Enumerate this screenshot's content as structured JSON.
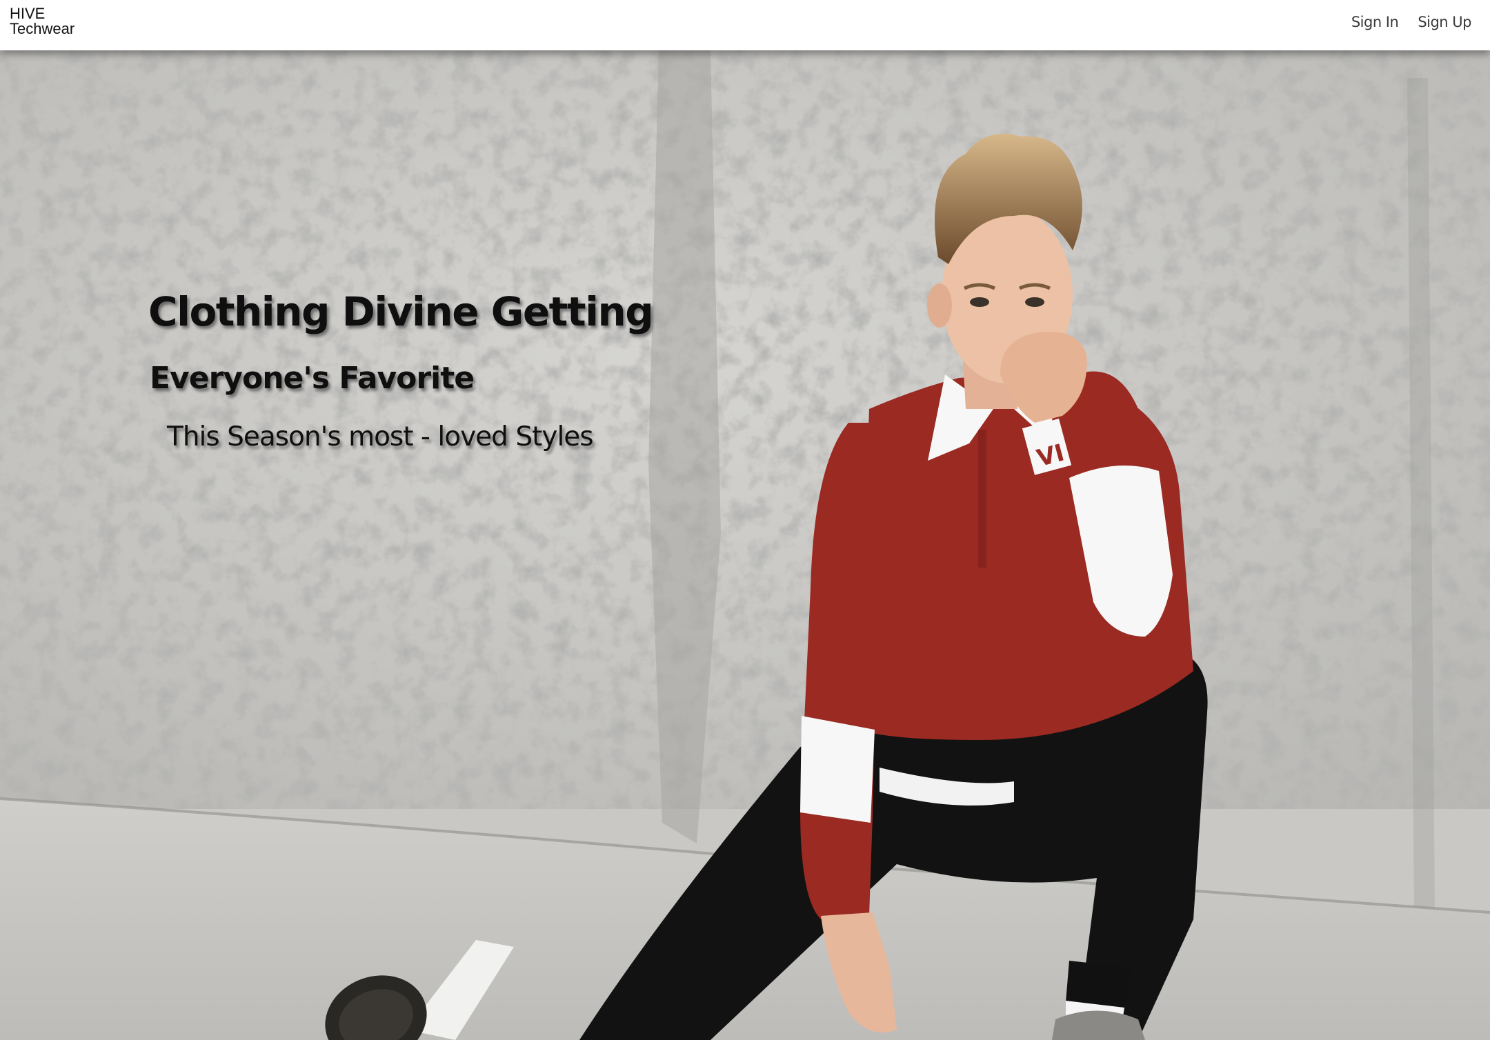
{
  "header": {
    "brand_line1": "HIVE",
    "brand_line2": "Techwear",
    "nav": {
      "sign_in": "Sign In",
      "sign_up": "Sign Up"
    }
  },
  "hero": {
    "title": "Clothing Divine Getting",
    "subtitle": "Everyone's Favorite",
    "tagline": "This Season's most - loved Styles",
    "shirt_print": "VI",
    "colors": {
      "wall": "#c9c8c5",
      "shirt": "#9a2a22",
      "stripe": "#f7f7f7",
      "pants": "#121212"
    }
  }
}
